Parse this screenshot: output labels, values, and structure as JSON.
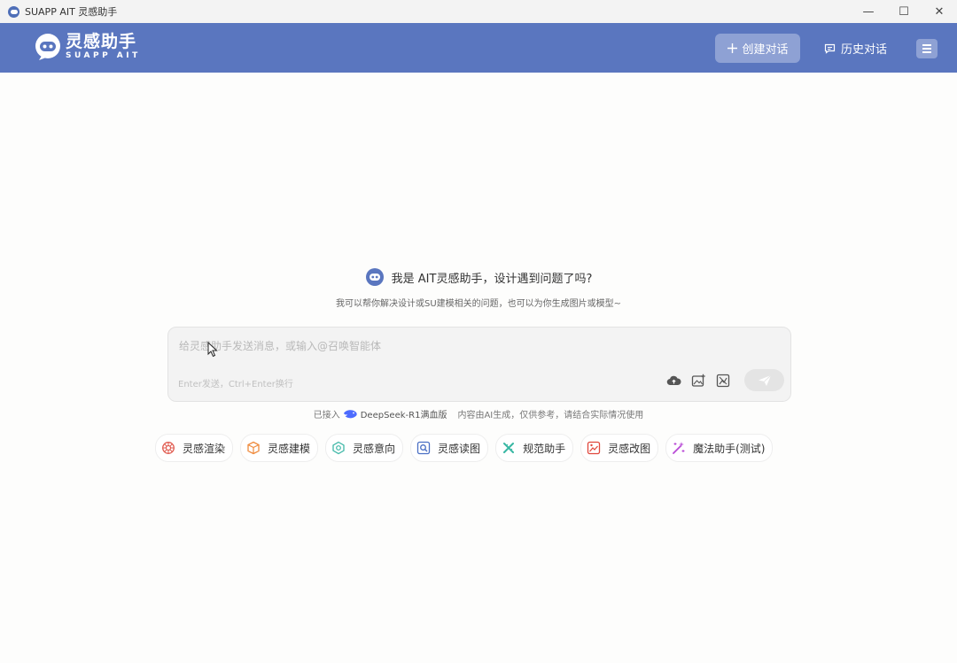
{
  "window": {
    "title": "SUAPP AIT 灵感助手",
    "controls": [
      "—",
      "☐",
      "✕"
    ]
  },
  "header": {
    "logo_cn": "灵感助手",
    "logo_en": "SUAPP AIT",
    "new_chat_label": "创建对话",
    "history_label": "历史对话"
  },
  "greeting": {
    "title": "我是 AIT灵感助手，设计遇到问题了吗?",
    "subtitle": "我可以帮你解决设计或SU建模相关的问题，也可以为你生成图片或模型~"
  },
  "composer": {
    "placeholder": "给灵感助手发送消息，或输入@召唤智能体",
    "value": "",
    "hint": "Enter发送，Ctrl+Enter换行"
  },
  "disclaimer": {
    "prefix": "已接入",
    "model": "DeepSeek-R1满血版",
    "note": "内容由AI生成，仅供参考，请结合实际情况使用"
  },
  "tools": [
    {
      "label": "灵感渲染",
      "icon": "render-icon",
      "color": "#e05a4f"
    },
    {
      "label": "灵感建模",
      "icon": "cube-icon",
      "color": "#ef8a3c"
    },
    {
      "label": "灵感意向",
      "icon": "idea-icon",
      "color": "#3fb8a8"
    },
    {
      "label": "灵感读图",
      "icon": "read-image-icon",
      "color": "#4a6fc4"
    },
    {
      "label": "规范助手",
      "icon": "rule-icon",
      "color": "#37b7a3"
    },
    {
      "label": "灵感改图",
      "icon": "edit-image-icon",
      "color": "#e0473c"
    },
    {
      "label": "魔法助手(测试)",
      "icon": "magic-wand-icon",
      "color": "#b84ad6"
    }
  ],
  "colors": {
    "header_bg": "#5a76bf",
    "button_bg": "#8ea1d4",
    "composer_bg": "#f3f3f3"
  }
}
